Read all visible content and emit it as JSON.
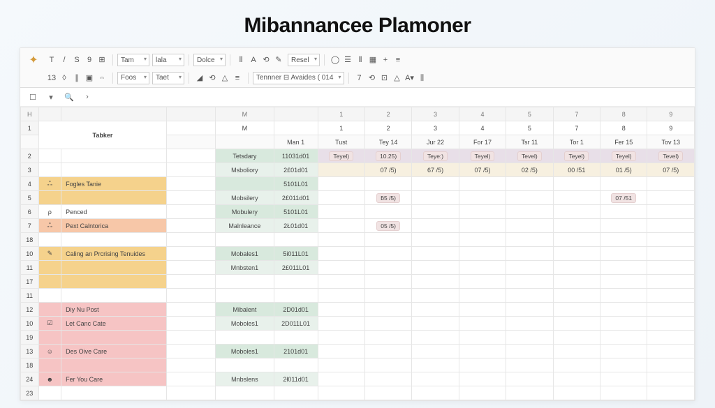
{
  "title": "Mibannancee Plamoner",
  "toolbar": {
    "row1": {
      "selects": [
        "Tam",
        "lala",
        "Dolce",
        "Resel"
      ],
      "icons_a": [
        "T",
        "/",
        "S",
        "9",
        "⊞"
      ],
      "icons_b": [
        "⫴",
        "A",
        "⟲",
        "✎"
      ],
      "icons_c": [
        "◯",
        "☰",
        "⫴",
        "▦",
        "+",
        "≡"
      ]
    },
    "row2": {
      "icons_a": [
        "13",
        "◊",
        "∥",
        "▣",
        "𝄐"
      ],
      "selects": [
        "Foos",
        "Taet"
      ],
      "icons_b": [
        "◢",
        "⟲",
        "△",
        "≡"
      ],
      "label": "Tennner ⊟  Avaides ( 014",
      "icons_c": [
        "7",
        "⟲",
        "⊡",
        "△",
        "A▾",
        "⫼"
      ]
    }
  },
  "nav": {
    "icons": [
      "☐",
      "▾",
      "🔍",
      "›"
    ]
  },
  "colLetters": [
    "H",
    "",
    "",
    "",
    "M",
    "",
    "1",
    "2",
    "3",
    "4",
    "5",
    "7",
    "8",
    "9"
  ],
  "header2": [
    "",
    "",
    "",
    "",
    "",
    "Man 1",
    "Tust",
    "Tey 14",
    "Jur 22",
    "For 17",
    "Tsr 11",
    "Tor 1",
    "Fer 15",
    "Tov 13"
  ],
  "tasksHeader": "Tabker",
  "rows": [
    {
      "n": "2",
      "icon": "",
      "task": "",
      "m": "Tetsdary",
      "date": "11031d01",
      "d": [
        "Teyel)",
        "10.25)",
        "Teye:)",
        "Teyel)",
        "Tevel)",
        "Teyel)",
        "Teyel)",
        "Tevel)"
      ],
      "taskBg": "",
      "mBg": "bg-mint",
      "pillAll": true,
      "rowBg": "bg-lav"
    },
    {
      "n": "3",
      "icon": "",
      "task": "",
      "m": "Msboliory",
      "date": "2£01d01",
      "d": [
        "",
        "07 /5)",
        "67 /5)",
        "07 /5)",
        "02 /5)",
        "00 /51",
        "01 /5)",
        "07 /5)"
      ],
      "taskBg": "",
      "mBg": "bg-mint2",
      "rowBg": "bg-cream"
    },
    {
      "n": "4",
      "icon": "ஃ",
      "task": "Fogles Tanie",
      "m": "",
      "date": "5101L01",
      "d": [
        "",
        "",
        "",
        "",
        "",
        "",
        "",
        ""
      ],
      "taskBg": "bg-amber",
      "mBg": "bg-mint"
    },
    {
      "n": "5",
      "icon": "",
      "task": "",
      "m": "Mobsilery",
      "date": "2£011d01",
      "d": [
        "",
        "ƃ5 /5)",
        "",
        "",
        "",
        "",
        "07 /51",
        ""
      ],
      "taskBg": "bg-amber",
      "mBg": "bg-mint2",
      "pillCols": [
        1,
        6
      ]
    },
    {
      "n": "6",
      "icon": "ρ",
      "task": "Penced",
      "muted": true,
      "m": "Mobulery",
      "date": "5101L01",
      "d": [
        "",
        "",
        "",
        "",
        "",
        "",
        "",
        ""
      ],
      "taskBg": "",
      "mBg": "bg-mint"
    },
    {
      "n": "7",
      "icon": "ஃ",
      "task": "Pext Calntorica",
      "m": "Malnleance",
      "date": "2Ł01d01",
      "d": [
        "",
        "05 /5)",
        "",
        "",
        "",
        "",
        "",
        ""
      ],
      "taskBg": "bg-peach",
      "mBg": "bg-mint2",
      "pillCols": [
        1
      ]
    },
    {
      "n": "18",
      "icon": "",
      "task": "",
      "m": "",
      "date": "",
      "d": [
        "",
        "",
        "",
        "",
        "",
        "",
        "",
        ""
      ],
      "taskBg": ""
    },
    {
      "n": "10",
      "icon": "✎",
      "task": "Caling an Prcrising Tenuides",
      "m": "Mobales1",
      "date": "5i011L01",
      "d": [
        "",
        "",
        "",
        "",
        "",
        "",
        "",
        ""
      ],
      "taskBg": "bg-amber",
      "mBg": "bg-mint",
      "tall": true
    },
    {
      "n": "11",
      "icon": "",
      "task": "",
      "m": "Mnbsten1",
      "date": "2£011L01",
      "d": [
        "",
        "",
        "",
        "",
        "",
        "",
        "",
        ""
      ],
      "taskBg": "bg-amber",
      "mBg": "bg-mint2",
      "cont": true
    },
    {
      "n": "17",
      "icon": "",
      "task": "",
      "m": "",
      "date": "",
      "d": [
        "",
        "",
        "",
        "",
        "",
        "",
        "",
        ""
      ],
      "taskBg": "bg-amber",
      "cont": true
    },
    {
      "n": "11",
      "icon": "",
      "task": "",
      "m": "",
      "date": "",
      "d": [
        "",
        "",
        "",
        "",
        "",
        "",
        "",
        ""
      ],
      "taskBg": ""
    },
    {
      "n": "12",
      "icon": "",
      "task": "Diy Nu Post",
      "m": "Mibalent",
      "date": "2D01d01",
      "d": [
        "",
        "",
        "",
        "",
        "",
        "",
        "",
        ""
      ],
      "taskBg": "bg-rose",
      "mBg": "bg-mint",
      "center": true
    },
    {
      "n": "10",
      "icon": "☑",
      "task": "Let Canc Cate",
      "m": "Moboles1",
      "date": "2D011L01",
      "d": [
        "",
        "",
        "",
        "",
        "",
        "",
        "",
        ""
      ],
      "taskBg": "bg-rose",
      "mBg": "bg-mint2"
    },
    {
      "n": "19",
      "icon": "",
      "task": "",
      "m": "",
      "date": "",
      "d": [
        "",
        "",
        "",
        "",
        "",
        "",
        "",
        ""
      ],
      "taskBg": "bg-rose",
      "cont": true
    },
    {
      "n": "13",
      "icon": "☺",
      "task": "Des Oive Care",
      "m": "Moboles1",
      "date": "2101d01",
      "d": [
        "",
        "",
        "",
        "",
        "",
        "",
        "",
        ""
      ],
      "taskBg": "bg-rose",
      "mBg": "bg-mint"
    },
    {
      "n": "18",
      "icon": "",
      "task": "",
      "m": "",
      "date": "",
      "d": [
        "",
        "",
        "",
        "",
        "",
        "",
        "",
        ""
      ],
      "taskBg": "bg-rose",
      "cont": true
    },
    {
      "n": "24",
      "icon": "☻",
      "task": "Fer You Care",
      "m": "Mnbslens",
      "date": "2ł011d01",
      "d": [
        "",
        "",
        "",
        "",
        "",
        "",
        "",
        ""
      ],
      "taskBg": "bg-rose",
      "mBg": "bg-mint2"
    },
    {
      "n": "23",
      "icon": "",
      "task": "",
      "m": "",
      "date": "",
      "d": [
        "",
        "",
        "",
        "",
        "",
        "",
        "",
        ""
      ],
      "taskBg": ""
    }
  ]
}
